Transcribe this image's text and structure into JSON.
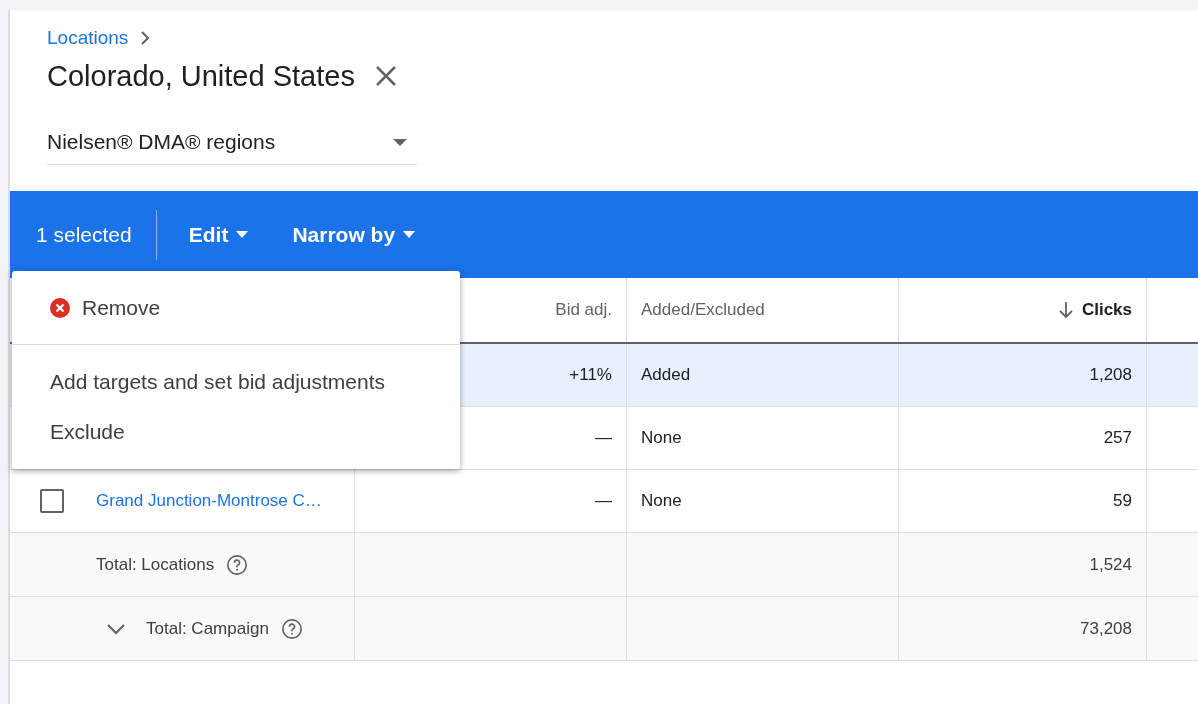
{
  "breadcrumb": {
    "label": "Locations"
  },
  "title": "Colorado, United States",
  "region_dropdown": {
    "value": "Nielsen® DMA® regions"
  },
  "action_bar": {
    "selected_count": "1 selected",
    "menus": [
      {
        "label": "Edit"
      },
      {
        "label": "Narrow by"
      }
    ]
  },
  "menu": {
    "groups": [
      [
        {
          "kind": "remove",
          "label": "Remove"
        }
      ],
      [
        {
          "kind": "plain",
          "label": "Add targets and set bid adjustments"
        },
        {
          "kind": "plain",
          "label": "Exclude"
        }
      ]
    ]
  },
  "table": {
    "columns": [
      {
        "label": "Bid adj.",
        "sorted": false
      },
      {
        "label": "Added/Excluded",
        "sorted": false
      },
      {
        "label": "Clicks",
        "sorted": true
      }
    ],
    "rows": [
      {
        "selected": true,
        "bid_adj": "+11%",
        "status": "Added",
        "clicks": "1,208"
      },
      {
        "selected": false,
        "bid_adj": "—",
        "status": "None",
        "clicks": "257"
      },
      {
        "selected": false,
        "checked": false,
        "name": "Grand Junction-Montrose C…",
        "bid_adj": "—",
        "status": "None",
        "clicks": "59"
      }
    ],
    "totals": [
      {
        "label": "Total: Locations",
        "collapsible": false,
        "clicks": "1,524"
      },
      {
        "label": "Total: Campaign",
        "collapsible": true,
        "clicks": "73,208"
      }
    ]
  }
}
